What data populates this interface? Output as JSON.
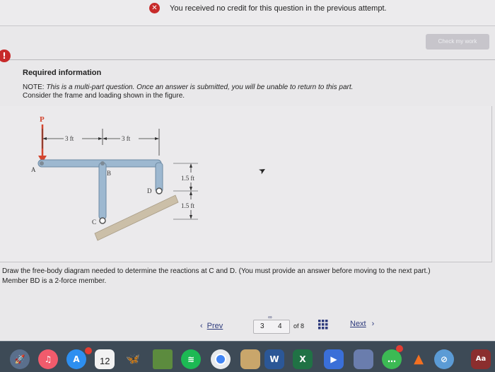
{
  "banner": {
    "message": "You received no credit for this question in the previous attempt."
  },
  "toolbar": {
    "check_label": "Check my work"
  },
  "alert": {
    "symbol": "!"
  },
  "question": {
    "title": "Required information",
    "note_prefix": "NOTE:",
    "note_italic": "This is a multi-part question. Once an answer is submitted, you will be unable to return to this part.",
    "intro": "Consider the frame and loading shown in the figure.",
    "prompt": "Draw the free-body diagram needed to determine the reactions at C and D. (You must provide an answer before moving to the next part.)",
    "member_note": "Member BD is a 2-force member."
  },
  "figure": {
    "load_label": "P",
    "dim_1": "3 ft",
    "dim_2": "3 ft",
    "dim_3": "1.5 ft",
    "dim_4": "1.5 ft",
    "point_a": "A",
    "point_b": "B",
    "point_c": "C",
    "point_d": "D"
  },
  "navigation": {
    "prev_label": "Prev",
    "page_current": "3",
    "page_next": "4",
    "page_of": "of 8",
    "next_label": "Next"
  },
  "dock": {
    "calendar_day": "12",
    "word_letter": "W",
    "excel_letter": "X",
    "dictionary_label": "Aa"
  },
  "colors": {
    "error_red": "#c72a2a",
    "link_blue": "#2d3a7c",
    "frame_blue": "#9db8d0",
    "dock_bg": "#3d4a56"
  }
}
